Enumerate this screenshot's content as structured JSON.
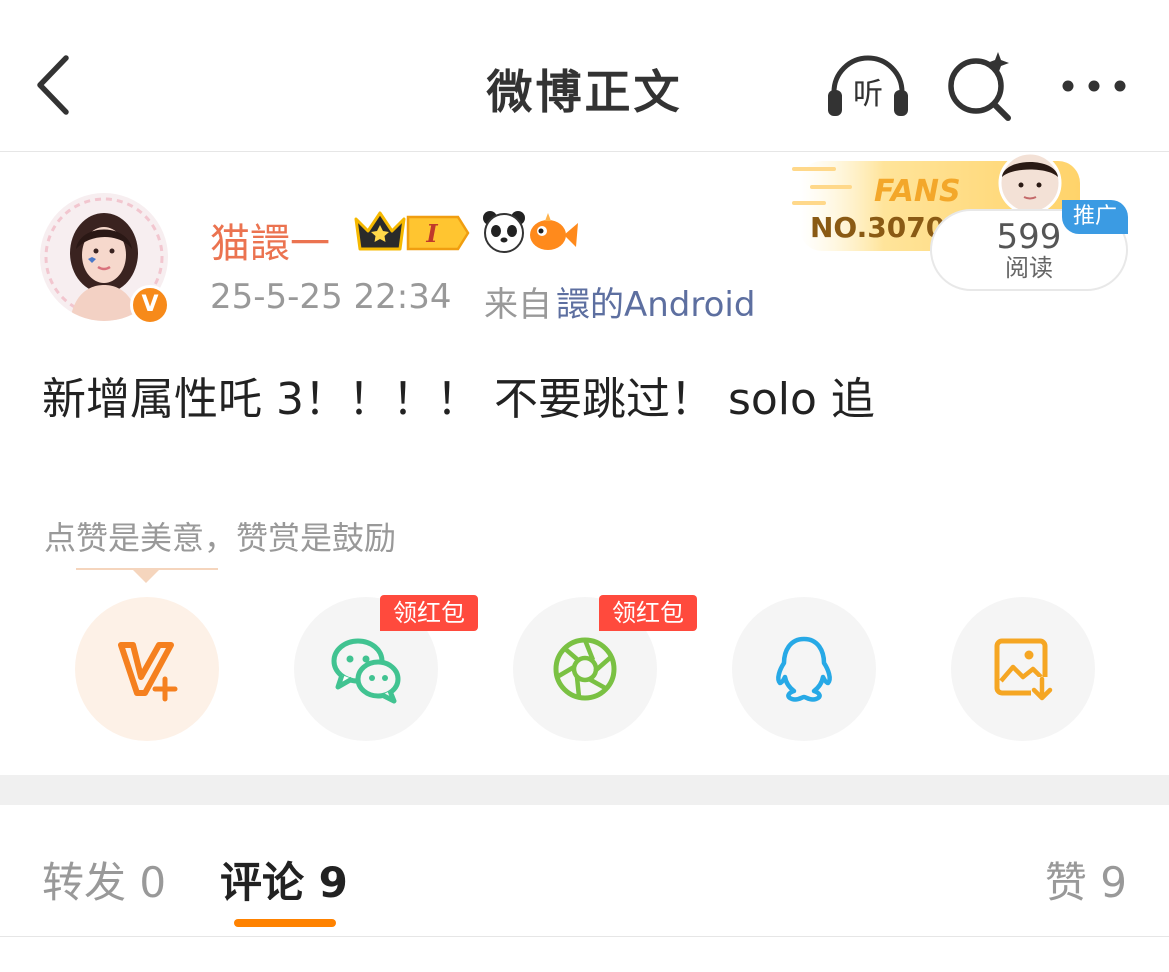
{
  "nav": {
    "title": "微博正文",
    "listen_label": "听"
  },
  "post": {
    "username": "猫譞一",
    "level_badge": "I",
    "time": "25-5-25 22:34",
    "from_prefix": "来自",
    "source": "譞的Android",
    "fans_title": "FANS",
    "fans_no": "NO.30702",
    "read_count": "599",
    "read_label": "阅读",
    "ad_tag": "推广",
    "text": "新增属性吒 3！！！！ 不要跳过！ solo 追",
    "reward_hint": "点赞是美意，赞赏是鼓励",
    "share_red_tag_1": "领红包",
    "share_red_tag_2": "领红包"
  },
  "tabs": {
    "repost": "转发 0",
    "comment": "评论 9",
    "like": "赞 9"
  },
  "colors": {
    "brand_orange": "#ff8200",
    "username": "#eb7350",
    "link": "#5d6fa0",
    "red_tag": "#ff4a3d",
    "wechat": "#41c391",
    "moments": "#7ac143",
    "qq": "#27a9e6",
    "save": "#f5a623"
  },
  "icons": [
    "back-arrow-icon",
    "headphones-icon",
    "search-sparkle-icon",
    "more-dots-icon",
    "verified-v-icon",
    "crown-icon",
    "panda-icon",
    "fish-icon",
    "reward-v-plus-icon",
    "wechat-icon",
    "moments-icon",
    "qq-icon",
    "save-image-icon"
  ]
}
